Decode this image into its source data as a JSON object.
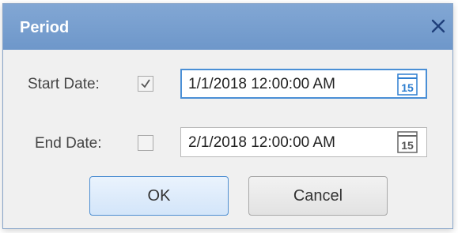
{
  "dialog": {
    "title": "Period",
    "close_icon": "close-icon"
  },
  "start": {
    "label": "Start Date:",
    "checked": true,
    "value": "1/1/2018 12:00:00 AM",
    "calendar_day": "15",
    "calendar_icon": "calendar-icon",
    "calendar_color": "#2f7fd0"
  },
  "end": {
    "label": "End Date:",
    "checked": false,
    "value": "2/1/2018 12:00:00 AM",
    "calendar_day": "15",
    "calendar_icon": "calendar-icon",
    "calendar_color": "#666666"
  },
  "buttons": {
    "ok_label": "OK",
    "cancel_label": "Cancel"
  },
  "colors": {
    "titlebar": "#7aa0d0",
    "accent": "#4a8fd6"
  }
}
